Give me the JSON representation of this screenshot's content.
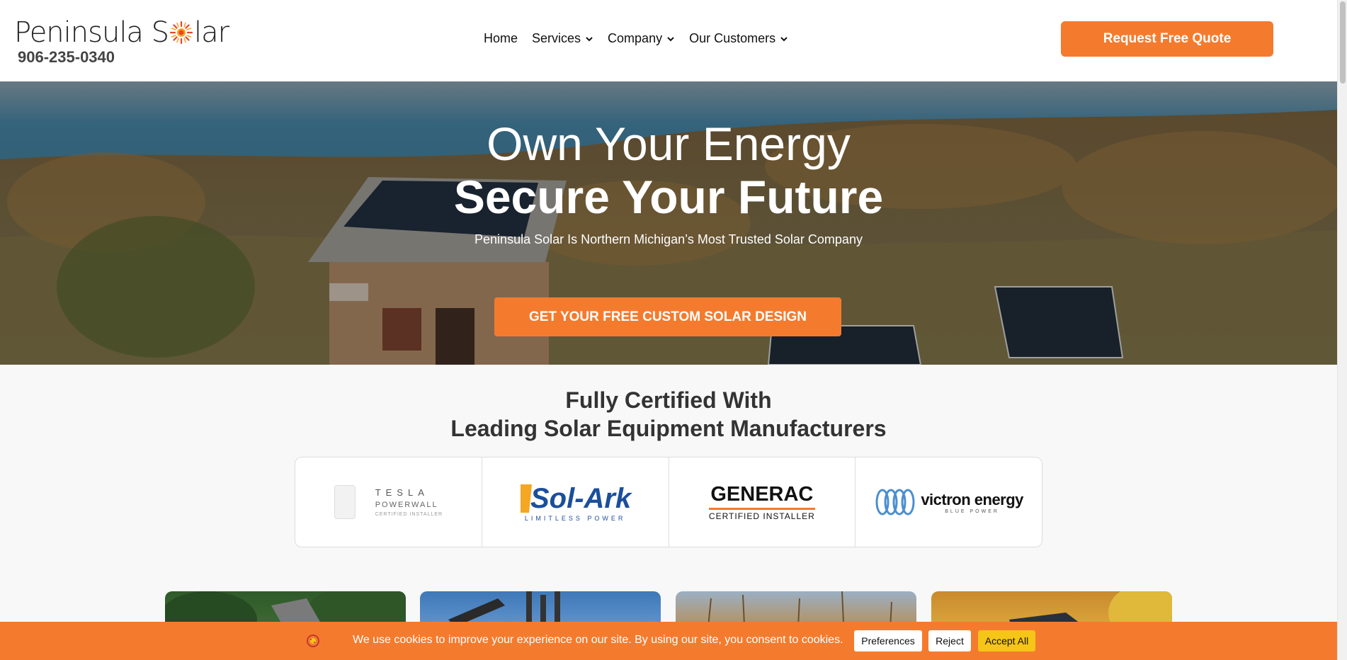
{
  "header": {
    "logo_text_before": "Peninsula S",
    "logo_text_after": "lar",
    "phone": "906-235-0340",
    "nav": [
      {
        "label": "Home",
        "dropdown": false
      },
      {
        "label": "Services",
        "dropdown": true
      },
      {
        "label": "Company",
        "dropdown": true
      },
      {
        "label": "Our Customers",
        "dropdown": true
      }
    ],
    "quote_button": "Request Free Quote"
  },
  "hero": {
    "title_line1": "Own Your Energy",
    "title_line2": "Secure Your Future",
    "subtitle": "Peninsula Solar Is Northern Michigan’s Most Trusted Solar Company",
    "cta": "GET YOUR FREE CUSTOM SOLAR DESIGN"
  },
  "certified": {
    "title_line1": "Fully Certified With",
    "title_line2": "Leading Solar Equipment Manufacturers",
    "logos": [
      {
        "name": "tesla-powerwall",
        "line1": "TESLA",
        "line2": "POWERWALL",
        "line3": "CERTIFIED INSTALLER"
      },
      {
        "name": "sol-ark",
        "line1": "Sol-Ark",
        "line2": "LIMITLESS POWER"
      },
      {
        "name": "generac",
        "line1": "GENERAC",
        "line2": "CERTIFIED INSTALLER"
      },
      {
        "name": "victron-energy",
        "line1": "victron energy",
        "line2": "BLUE POWER"
      }
    ]
  },
  "cookie": {
    "text": "We use cookies to improve your experience on our site. By using our site, you consent to cookies.",
    "preferences": "Preferences",
    "reject": "Reject",
    "accept": "Accept All"
  },
  "colors": {
    "accent": "#f47b2e",
    "accept": "#f5c518"
  }
}
